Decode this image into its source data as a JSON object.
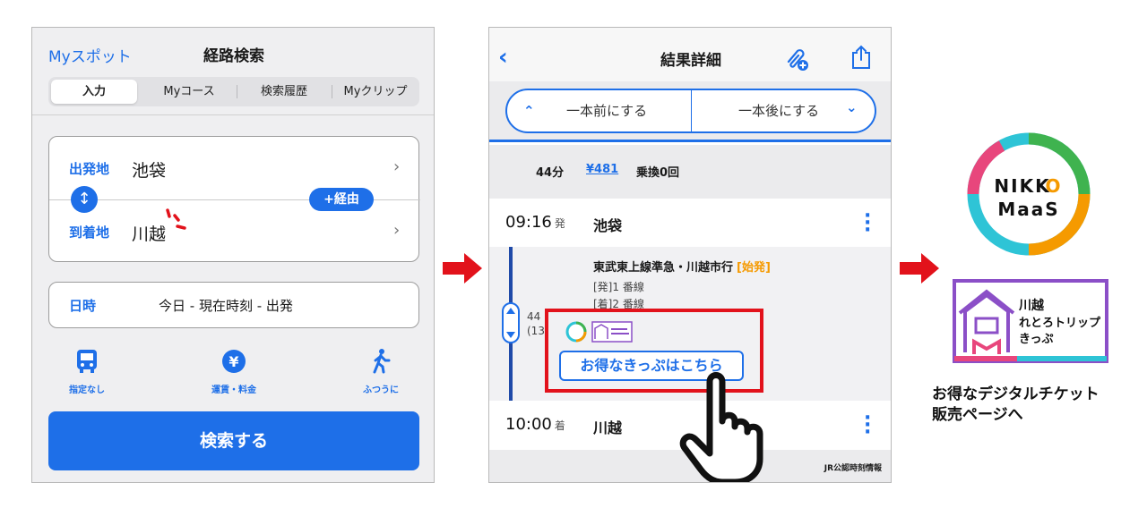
{
  "screen1": {
    "my_spot": "Myスポット",
    "title": "経路検索",
    "tabs": [
      "入力",
      "Myコース",
      "検索履歴",
      "Myクリップ"
    ],
    "departure_label": "出発地",
    "departure_value": "池袋",
    "arrival_label": "到着地",
    "arrival_value": "川越",
    "via_button": "+経由",
    "datetime_label": "日時",
    "datetime_value": "今日 - 現在時刻 - 出発",
    "options": [
      {
        "icon": "bus-icon",
        "label": "指定なし"
      },
      {
        "icon": "yen-icon",
        "label": "運賃・料金"
      },
      {
        "icon": "walker-icon",
        "label": "ふつうに"
      }
    ],
    "search_button": "検索する"
  },
  "screen2": {
    "title": "結果詳細",
    "prev_button": "一本前にする",
    "next_button": "一本後にする",
    "summary": {
      "duration": "44分",
      "fare": "¥481",
      "transfers": "乗換0回"
    },
    "departure": {
      "time": "09:16",
      "suffix": "発",
      "station": "池袋"
    },
    "train": {
      "line": "東武東上線準急・川越市行",
      "tag": "[始発]",
      "dep_platform": "[発]1 番線",
      "arr_platform": "[着]2 番線",
      "minutes": "44",
      "stops": "(13"
    },
    "ticket_button": "お得なきっぷはこちら",
    "arrival": {
      "time": "10:00",
      "suffix": "着",
      "station": "川越"
    },
    "footer": "JR公認時刻情報"
  },
  "right": {
    "logo_line1_a": "NIKK",
    "logo_line1_b": "O",
    "logo_line2": "MaaS",
    "ticket_logo_line1": "川越",
    "ticket_logo_line2": "れとろトリップ",
    "ticket_logo_line3": "きっぷ",
    "caption_line1": "お得なデジタルチケット",
    "caption_line2": "販売ページへ"
  },
  "colors": {
    "accent_blue": "#1e6fe8",
    "alert_red": "#e2121b",
    "tag_orange": "#f59a00"
  }
}
